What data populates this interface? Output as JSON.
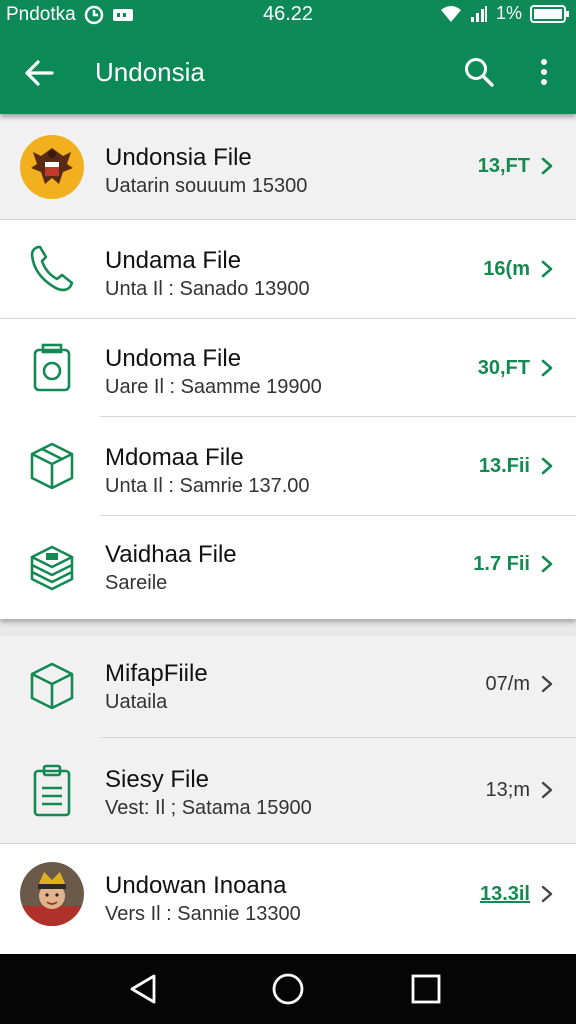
{
  "status_bar": {
    "carrier": "Pndotka",
    "time": "46.22",
    "battery": "1%"
  },
  "app_bar": {
    "title": "Undonsia",
    "back_icon": "arrow-back-icon",
    "search_icon": "search-icon",
    "more_icon": "more-vert-icon"
  },
  "files": [
    {
      "name": "Undonsia File",
      "subtitle": "Uatarin souuum 15300",
      "size": "13,FT",
      "icon": "emblem-avatar"
    },
    {
      "name": "Undama File",
      "subtitle": "Unta Il : Sanado 13900",
      "size": "16(m",
      "icon": "phone-icon"
    },
    {
      "name": "Undoma File",
      "subtitle": "Uare Il : Saamme 19900",
      "size": "30,FT",
      "icon": "camera-icon"
    },
    {
      "name": "Mdomaa File",
      "subtitle": "Unta Il : Samrie 137.00",
      "size": "13.Fii",
      "icon": "box-icon"
    },
    {
      "name": "Vaidhaa File",
      "subtitle": "Sareile",
      "size": "1.7 Fii",
      "icon": "stack-icon"
    }
  ],
  "files_secondary": [
    {
      "name": "MifapFiile",
      "subtitle": "Uataila",
      "size": "07/m",
      "icon": "box-icon"
    },
    {
      "name": "Siesy File",
      "subtitle": "Vest: Il ; Satama 15900",
      "size": "13;m",
      "icon": "clipboard-icon"
    },
    {
      "name": "Undowan Inoana",
      "subtitle": "Vers Il : Sannie 13300",
      "size": "13.3il",
      "icon": "person-avatar"
    }
  ],
  "colors": {
    "primary": "#0b8a57",
    "accent_text": "#138a52",
    "nav_bar": "#050505"
  },
  "nav_bar": {
    "back_icon": "nav-back-icon",
    "home_icon": "nav-home-icon",
    "recents_icon": "nav-recents-icon"
  }
}
